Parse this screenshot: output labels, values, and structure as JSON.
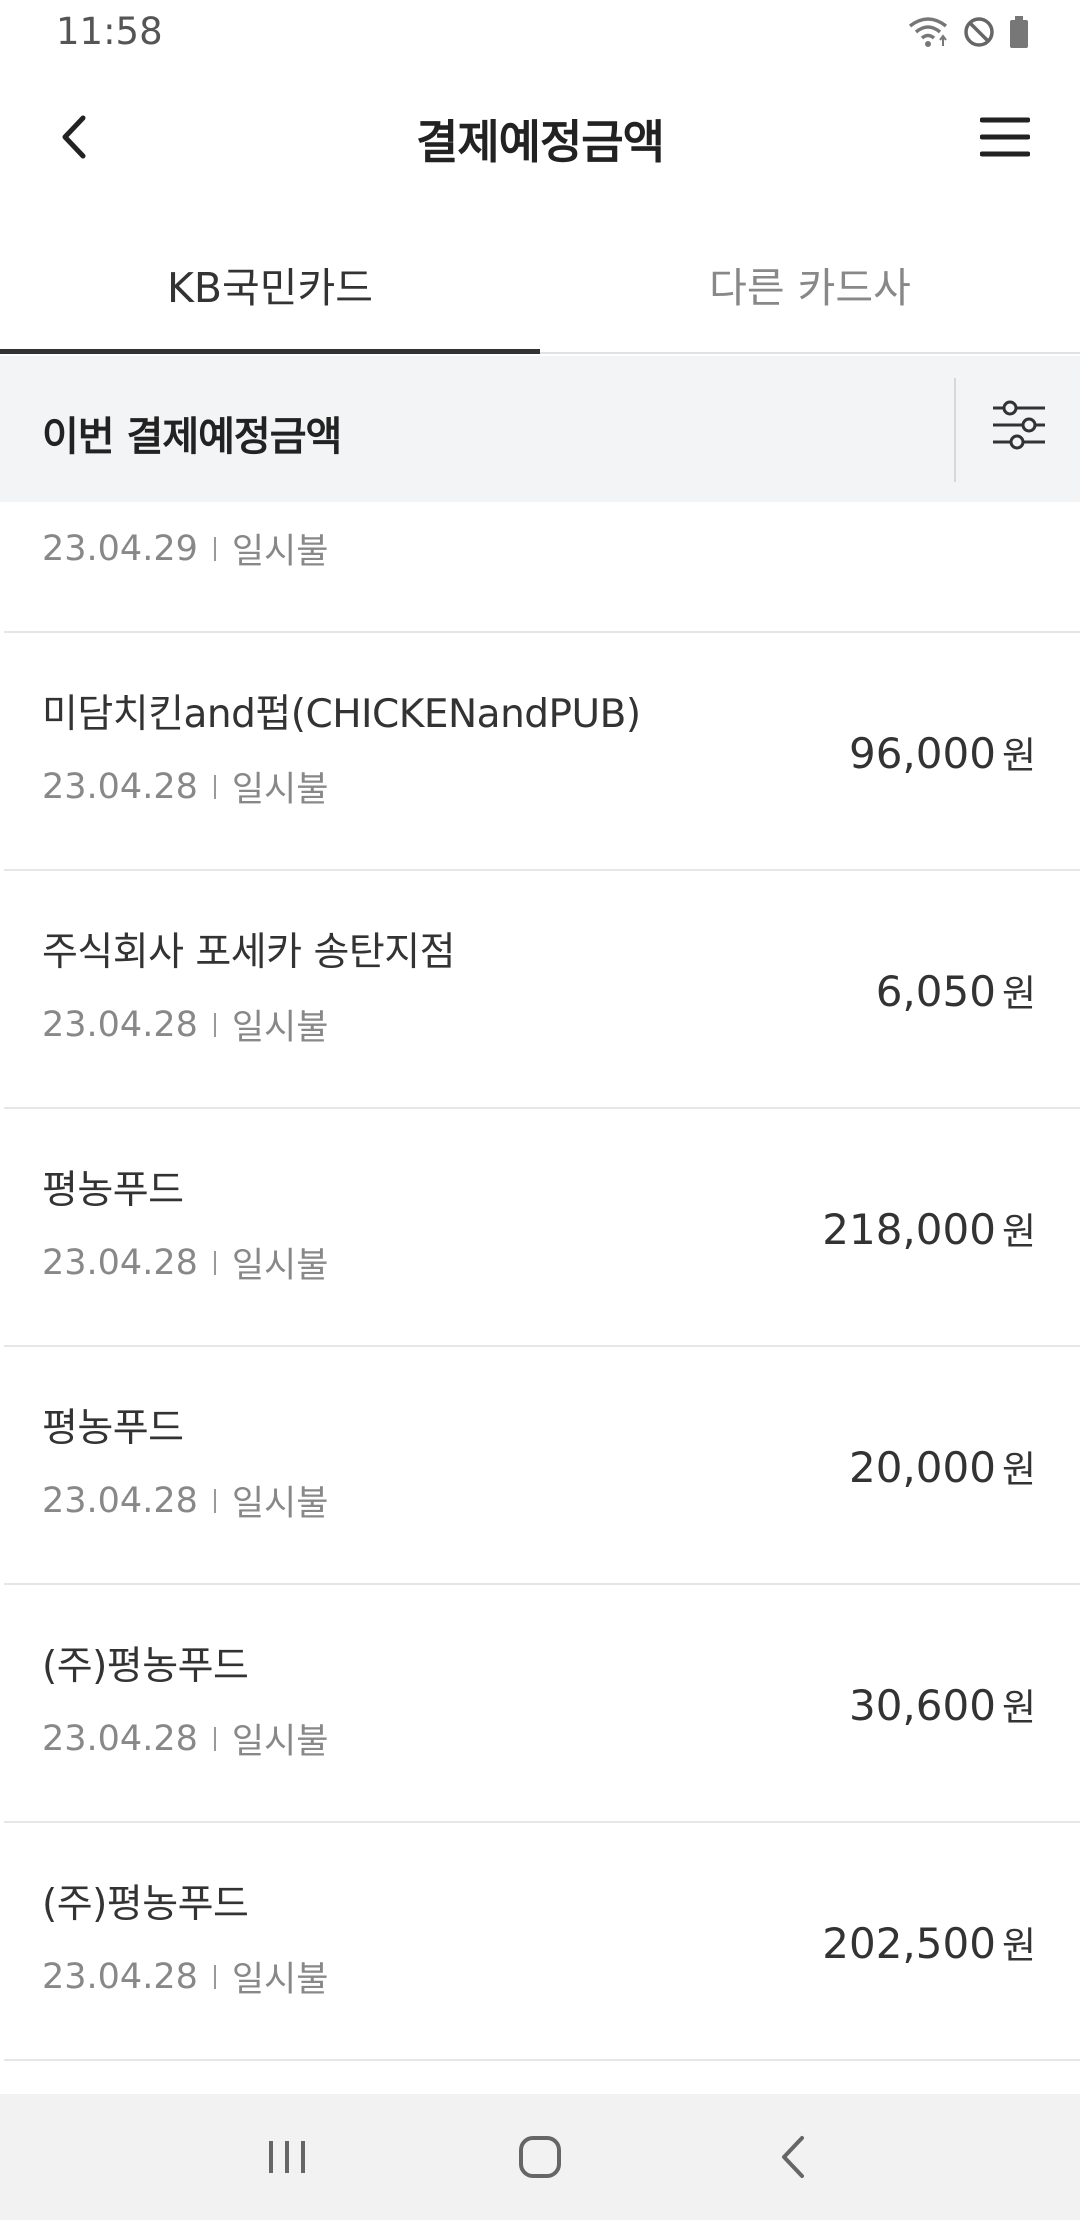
{
  "status_bar": {
    "time": "11:58",
    "icons": [
      "wifi-icon",
      "do-not-disturb-icon",
      "battery-icon"
    ]
  },
  "header": {
    "title": "결제예정금액",
    "back_icon": "chevron-left-icon",
    "menu_icon": "hamburger-menu-icon"
  },
  "tabs": [
    {
      "label": "KB국민카드",
      "active": true
    },
    {
      "label": "다른 카드사",
      "active": false
    }
  ],
  "section": {
    "title": "이번 결제예정금액",
    "filter_icon": "filter-sliders-icon"
  },
  "transactions": [
    {
      "name": "",
      "date": "23.04.29",
      "type": "일시불",
      "amount": ",",
      "unit": ""
    },
    {
      "name": "미담치킨and펍(CHICKENandPUB)",
      "date": "23.04.28",
      "type": "일시불",
      "amount": "96,000",
      "unit": "원"
    },
    {
      "name": "주식회사 포세카 송탄지점",
      "date": "23.04.28",
      "type": "일시불",
      "amount": "6,050",
      "unit": "원"
    },
    {
      "name": "평농푸드",
      "date": "23.04.28",
      "type": "일시불",
      "amount": "218,000",
      "unit": "원"
    },
    {
      "name": "평농푸드",
      "date": "23.04.28",
      "type": "일시불",
      "amount": "20,000",
      "unit": "원"
    },
    {
      "name": "(주)평농푸드",
      "date": "23.04.28",
      "type": "일시불",
      "amount": "30,600",
      "unit": "원"
    },
    {
      "name": "(주)평농푸드",
      "date": "23.04.28",
      "type": "일시불",
      "amount": "202,500",
      "unit": "원"
    }
  ],
  "nav_bar": {
    "recents_icon": "recent-apps-icon",
    "home_icon": "home-icon",
    "back_icon": "nav-back-icon"
  },
  "colors": {
    "text_primary": "#222222",
    "text_secondary": "#888888",
    "section_bg": "#f3f4f6",
    "divider": "#e6e6e6",
    "nav_bg": "#f2f2f2"
  }
}
